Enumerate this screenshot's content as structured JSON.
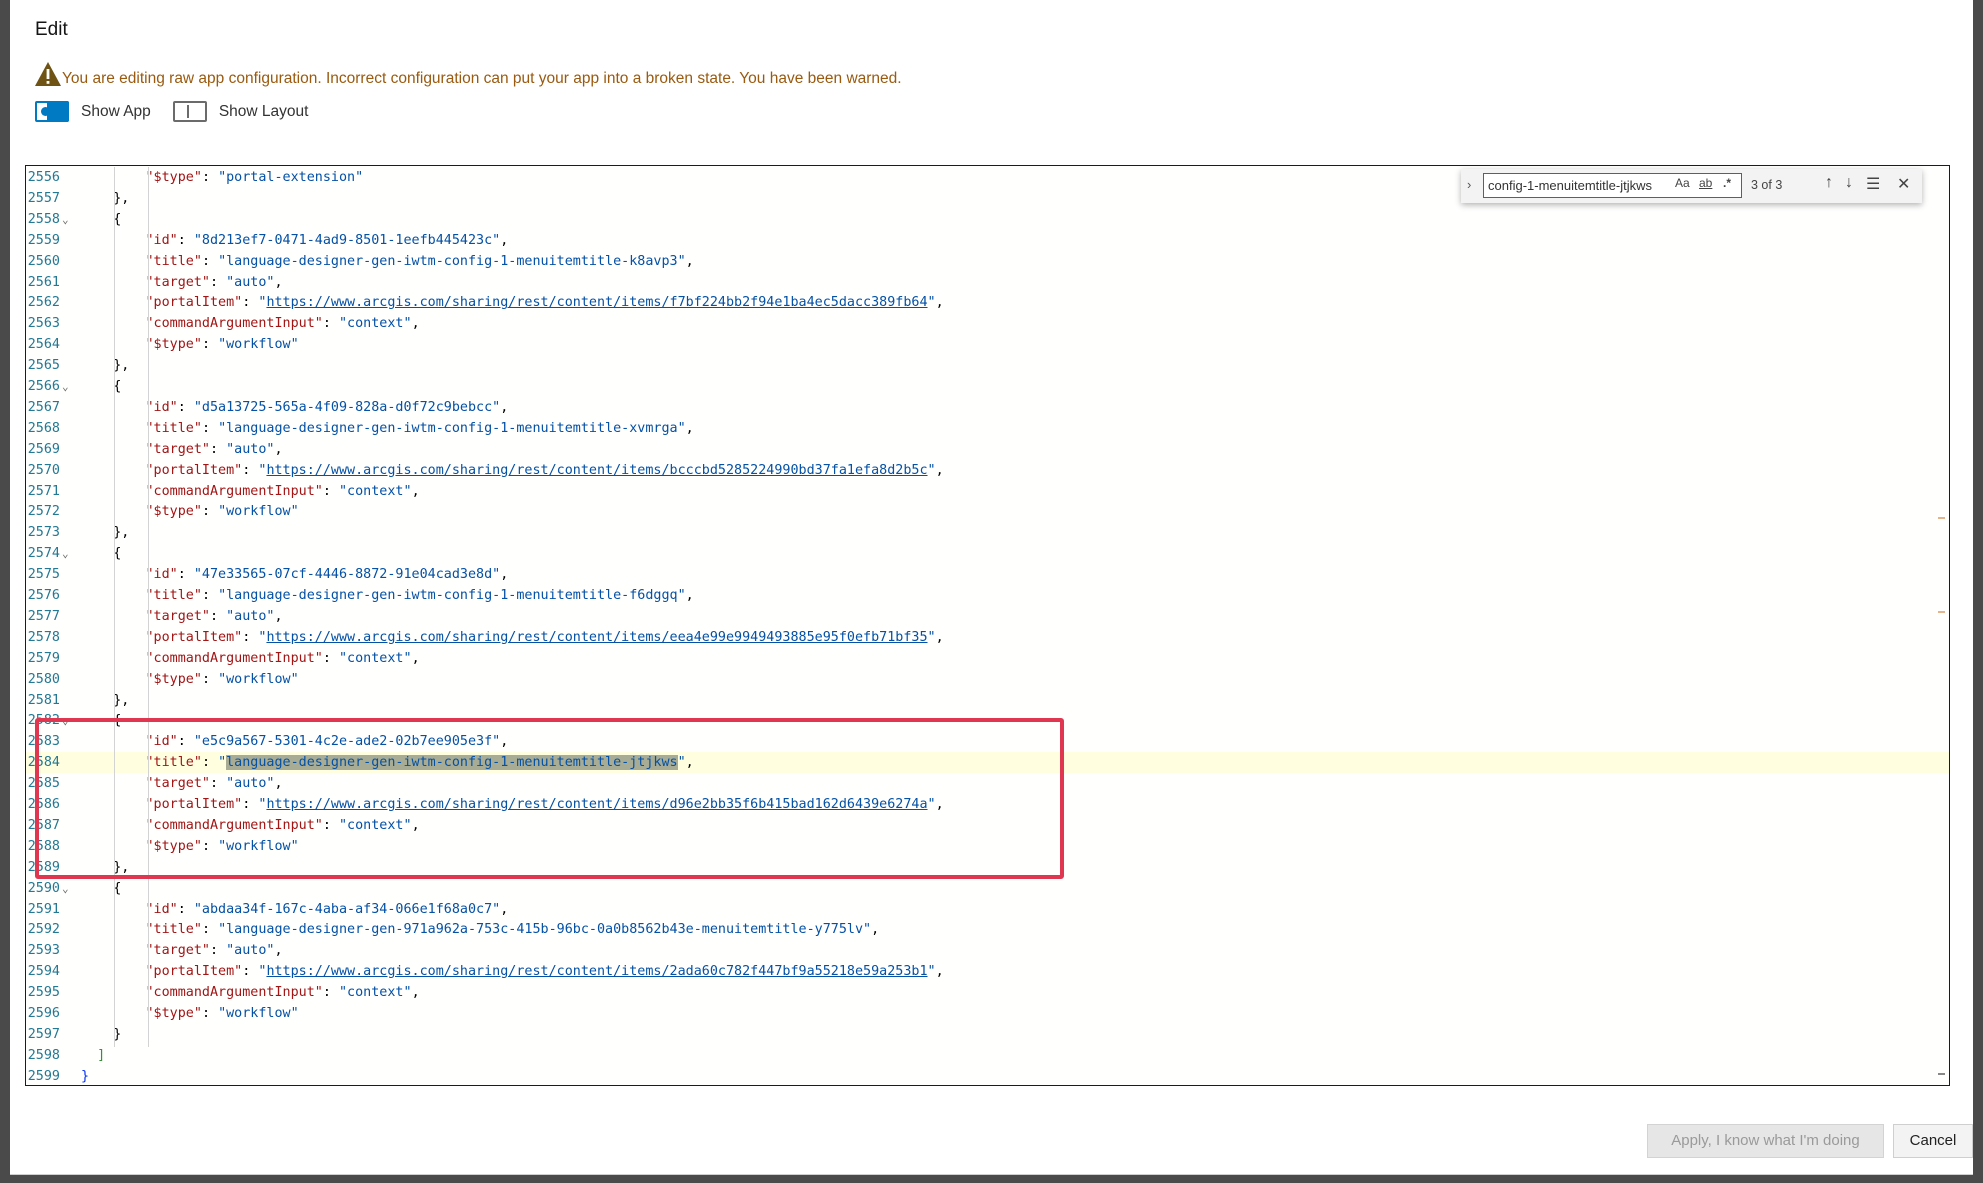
{
  "dialog": {
    "title": "Edit",
    "warning": "You are editing raw app configuration. Incorrect configuration can put your app into a broken state. You have been warned.",
    "toggles": [
      {
        "label": "Show App",
        "checked": true
      },
      {
        "label": "Show Layout",
        "checked": false
      }
    ],
    "buttons": {
      "apply": "Apply, I know what I'm doing",
      "cancel": "Cancel"
    }
  },
  "find": {
    "query": "config-1-menuitemtitle-jtjkws",
    "match_case": "Aa",
    "whole_word": "ab",
    "regex": ".*",
    "count": "3 of 3"
  },
  "editor": {
    "lines": [
      {
        "n": "2556",
        "t": "        \"$type\": \"portal-extension\""
      },
      {
        "n": "2557",
        "t": "    },"
      },
      {
        "n": "2558",
        "t": "    {",
        "fold": true
      },
      {
        "n": "2559",
        "t": "        \"id\": \"8d213ef7-0471-4ad9-8501-1eefb445423c\","
      },
      {
        "n": "2560",
        "t": "        \"title\": \"language-designer-gen-iwtm-config-1-menuitemtitle-k8avp3\","
      },
      {
        "n": "2561",
        "t": "        \"target\": \"auto\","
      },
      {
        "n": "2562",
        "t": "        \"portalItem\": \"https://www.arcgis.com/sharing/rest/content/items/f7bf224bb2f94e1ba4ec5dacc389fb64\","
      },
      {
        "n": "2563",
        "t": "        \"commandArgumentInput\": \"context\","
      },
      {
        "n": "2564",
        "t": "        \"$type\": \"workflow\""
      },
      {
        "n": "2565",
        "t": "    },"
      },
      {
        "n": "2566",
        "t": "    {",
        "fold": true
      },
      {
        "n": "2567",
        "t": "        \"id\": \"d5a13725-565a-4f09-828a-d0f72c9bebcc\","
      },
      {
        "n": "2568",
        "t": "        \"title\": \"language-designer-gen-iwtm-config-1-menuitemtitle-xvmrga\","
      },
      {
        "n": "2569",
        "t": "        \"target\": \"auto\","
      },
      {
        "n": "2570",
        "t": "        \"portalItem\": \"https://www.arcgis.com/sharing/rest/content/items/bcccbd5285224990bd37fa1efa8d2b5c\","
      },
      {
        "n": "2571",
        "t": "        \"commandArgumentInput\": \"context\","
      },
      {
        "n": "2572",
        "t": "        \"$type\": \"workflow\""
      },
      {
        "n": "2573",
        "t": "    },"
      },
      {
        "n": "2574",
        "t": "    {",
        "fold": true
      },
      {
        "n": "2575",
        "t": "        \"id\": \"47e33565-07cf-4446-8872-91e04cad3e8d\","
      },
      {
        "n": "2576",
        "t": "        \"title\": \"language-designer-gen-iwtm-config-1-menuitemtitle-f6dggq\","
      },
      {
        "n": "2577",
        "t": "        \"target\": \"auto\","
      },
      {
        "n": "2578",
        "t": "        \"portalItem\": \"https://www.arcgis.com/sharing/rest/content/items/eea4e99e9949493885e95f0efb71bf35\","
      },
      {
        "n": "2579",
        "t": "        \"commandArgumentInput\": \"context\","
      },
      {
        "n": "2580",
        "t": "        \"$type\": \"workflow\""
      },
      {
        "n": "2581",
        "t": "    },"
      },
      {
        "n": "2582",
        "t": "    {",
        "fold": true
      },
      {
        "n": "2583",
        "t": "        \"id\": \"e5c9a567-5301-4c2e-ade2-02b7ee905e3f\","
      },
      {
        "n": "2584",
        "t": "        \"title\": \"language-designer-gen-iwtm-config-1-menuitemtitle-jtjkws\",",
        "current": true
      },
      {
        "n": "2585",
        "t": "        \"target\": \"auto\","
      },
      {
        "n": "2586",
        "t": "        \"portalItem\": \"https://www.arcgis.com/sharing/rest/content/items/d96e2bb35f6b415bad162d6439e6274a\","
      },
      {
        "n": "2587",
        "t": "        \"commandArgumentInput\": \"context\","
      },
      {
        "n": "2588",
        "t": "        \"$type\": \"workflow\""
      },
      {
        "n": "2589",
        "t": "    },"
      },
      {
        "n": "2590",
        "t": "    {",
        "fold": true
      },
      {
        "n": "2591",
        "t": "        \"id\": \"abdaa34f-167c-4aba-af34-066e1f68a0c7\","
      },
      {
        "n": "2592",
        "t": "        \"title\": \"language-designer-gen-971a962a-753c-415b-96bc-0a0b8562b43e-menuitemtitle-y775lv\","
      },
      {
        "n": "2593",
        "t": "        \"target\": \"auto\","
      },
      {
        "n": "2594",
        "t": "        \"portalItem\": \"https://www.arcgis.com/sharing/rest/content/items/2ada60c782f447bf9a55218e59a253b1\","
      },
      {
        "n": "2595",
        "t": "        \"commandArgumentInput\": \"context\","
      },
      {
        "n": "2596",
        "t": "        \"$type\": \"workflow\""
      },
      {
        "n": "2597",
        "t": "    }"
      },
      {
        "n": "2598",
        "t": "  ]"
      },
      {
        "n": "2599",
        "t": "}"
      }
    ]
  },
  "colors": {
    "accent": "#007ac2",
    "warning": "#9a5a0f",
    "highlight_box": "#e0364f",
    "line_number": "#237893",
    "json_key": "#a31515",
    "json_string": "#0451a5"
  }
}
